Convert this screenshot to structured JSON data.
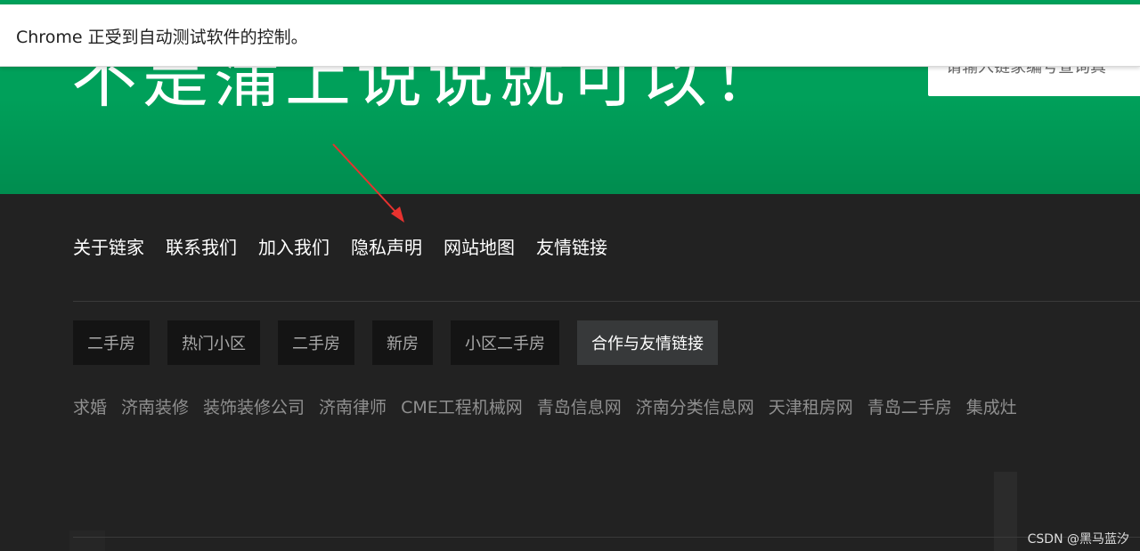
{
  "infobar": {
    "text": "Chrome 正受到自动测试软件的控制。"
  },
  "banner": {
    "slogan": "不是蒲上说说就可以！",
    "search_placeholder": "请输入链家编号查询真",
    "bg_color": "#00a05a"
  },
  "footer_nav": [
    {
      "label": "关于链家"
    },
    {
      "label": "联系我们"
    },
    {
      "label": "加入我们"
    },
    {
      "label": "隐私声明"
    },
    {
      "label": "网站地图"
    },
    {
      "label": "友情链接"
    }
  ],
  "tabs": [
    {
      "label": "二手房"
    },
    {
      "label": "热门小区"
    },
    {
      "label": "二手房"
    },
    {
      "label": "新房"
    },
    {
      "label": "小区二手房"
    },
    {
      "label": "合作与友情链接",
      "active": true
    }
  ],
  "links": [
    {
      "label": "求婚"
    },
    {
      "label": "济南装修"
    },
    {
      "label": "装饰装修公司"
    },
    {
      "label": "济南律师"
    },
    {
      "label": "CME工程机械网"
    },
    {
      "label": "青岛信息网"
    },
    {
      "label": "济南分类信息网"
    },
    {
      "label": "天津租房网"
    },
    {
      "label": "青岛二手房"
    },
    {
      "label": "集成灶"
    }
  ],
  "annotation": {
    "icon": "red-arrow-icon",
    "color": "#e8322f"
  },
  "watermark": "CSDN @黑马蓝汐"
}
